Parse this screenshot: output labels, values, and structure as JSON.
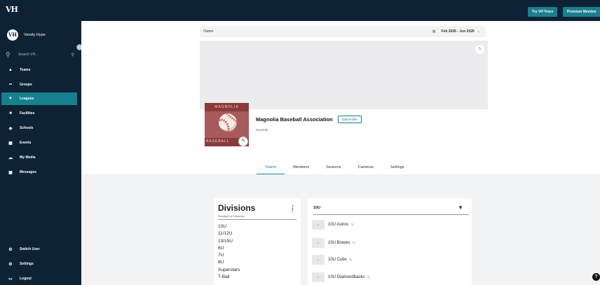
{
  "topbar": {
    "logo": "VH",
    "try_trace_label": "Try VH Trace",
    "premium_label": "Premium Member"
  },
  "sidebar": {
    "brand_logo": "VH",
    "brand_name": "Varsity Hype",
    "search_placeholder": "Search VH...",
    "items": [
      {
        "label": "Teams",
        "icon": "shirt-icon",
        "active": false
      },
      {
        "label": "Groups",
        "icon": "group-icon",
        "active": false
      },
      {
        "label": "Leagues",
        "icon": "trophy-icon",
        "active": true
      },
      {
        "label": "Facilities",
        "icon": "stadium-icon",
        "active": false
      },
      {
        "label": "Schools",
        "icon": "school-icon",
        "active": false
      },
      {
        "label": "Events",
        "icon": "calendar-icon",
        "active": false
      },
      {
        "label": "My Media",
        "icon": "cloud-icon",
        "active": false
      },
      {
        "label": "Messages",
        "icon": "chat-icon",
        "active": false
      }
    ],
    "bottom_items": [
      {
        "label": "Switch User",
        "icon": "gear-icon"
      },
      {
        "label": "Settings",
        "icon": "gear-icon"
      },
      {
        "label": "Logout",
        "icon": "logout-icon"
      }
    ]
  },
  "header": {
    "owner_label": "Owner",
    "date_range": "Feb 2026 - Jun 2026"
  },
  "profile": {
    "image_top_text": "MAGNOLIA",
    "image_bottom_text": "BASEBALL",
    "name": "Magnolia Baseball Association",
    "edit_profile_label": "Edit Profile",
    "sport": "Baseball"
  },
  "tabs": [
    {
      "label": "Teams",
      "active": true
    },
    {
      "label": "Members",
      "active": false
    },
    {
      "label": "Seasons",
      "active": false
    },
    {
      "label": "Cameras",
      "active": false
    },
    {
      "label": "Settings",
      "active": false
    }
  ],
  "divisions": {
    "title": "Divisions",
    "subtitle": "Showing 8 of 9 divisions",
    "items": [
      "10U",
      "11/12U",
      "13/15U",
      "6U",
      "7U",
      "8U",
      "Superstars",
      "T-Ball"
    ]
  },
  "teams": {
    "selected_division": "10U",
    "items": [
      "10U Astros",
      "10U Braves",
      "10U Cubs",
      "10U Diamondbacks"
    ]
  },
  "help_label": "?",
  "colors": {
    "sidebar": "#0d2235",
    "accent": "#17808f",
    "page_bg": "#f2f3f4"
  }
}
